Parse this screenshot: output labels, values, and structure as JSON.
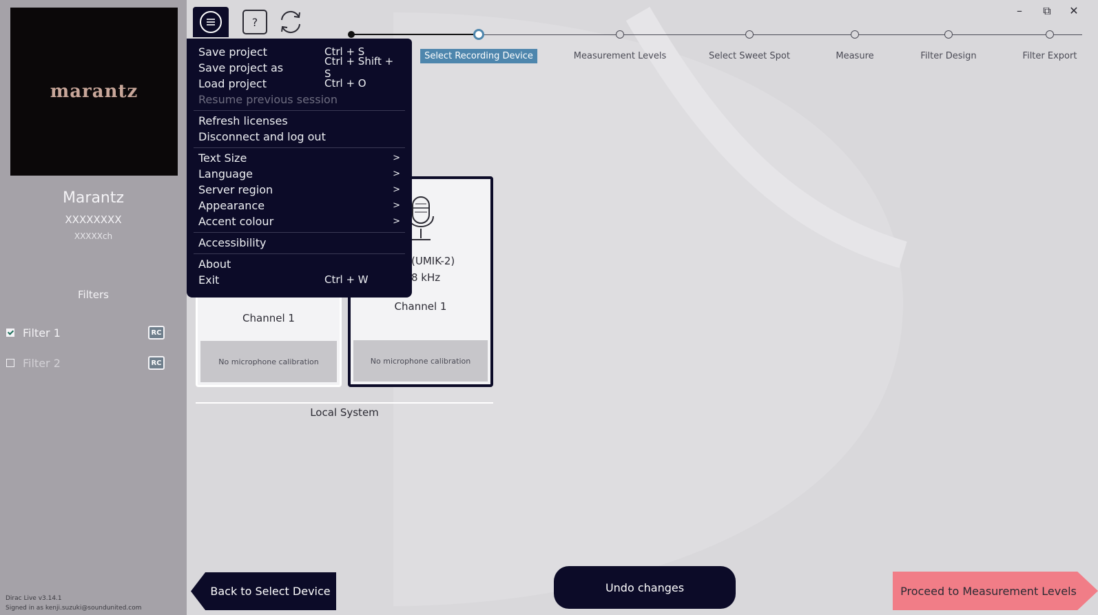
{
  "sidebar": {
    "logo_text": "marantz",
    "device_name": "Marantz",
    "device_serial": "XXXXXXXX",
    "device_channels": "XXXXXch",
    "filters_title": "Filters",
    "filters": [
      {
        "label": "Filter 1",
        "checked": true,
        "badge": "RC"
      },
      {
        "label": "Filter 2",
        "checked": false,
        "badge": "RC"
      }
    ],
    "version": "Dirac Live v3.14.1",
    "signed_in": "Signed in as kenji.suzuki@soundunited.com"
  },
  "toolbar": {
    "menu_icon": "hamburger-icon",
    "help_label": "?",
    "sync_icon": "sync-icon",
    "window_controls": {
      "minimize": "–",
      "maximize": "⧉",
      "close": "✕"
    }
  },
  "steps": [
    {
      "label": "Select Recording Device",
      "active": true
    },
    {
      "label": "Measurement Levels",
      "active": false
    },
    {
      "label": "Select Sweet Spot",
      "active": false
    },
    {
      "label": "Measure",
      "active": false
    },
    {
      "label": "Filter Design",
      "active": false
    },
    {
      "label": "Filter Export",
      "active": false
    }
  ],
  "devices": [
    {
      "line1": "",
      "line2": "",
      "channel": "Channel 1",
      "calibration": "No microphone calibration"
    },
    {
      "line1": "(UMIK-2)",
      "line2": "8 kHz",
      "channel": "Channel 1",
      "calibration": "No microphone calibration"
    }
  ],
  "local_system_label": "Local System",
  "menu": {
    "save": {
      "label": "Save project",
      "shortcut": "Ctrl + S"
    },
    "save_as": {
      "label": "Save project as",
      "shortcut": "Ctrl + Shift + S"
    },
    "load": {
      "label": "Load project",
      "shortcut": "Ctrl + O"
    },
    "resume": {
      "label": "Resume previous session"
    },
    "refresh": {
      "label": "Refresh licenses"
    },
    "disconnect": {
      "label": "Disconnect and log out"
    },
    "text_size": {
      "label": "Text Size",
      "arrow": ">"
    },
    "language": {
      "label": "Language",
      "arrow": ">"
    },
    "server_region": {
      "label": "Server region",
      "arrow": ">"
    },
    "appearance": {
      "label": "Appearance",
      "arrow": ">"
    },
    "accent_colour": {
      "label": "Accent colour",
      "arrow": ">"
    },
    "accessibility": {
      "label": "Accessibility"
    },
    "about": {
      "label": "About"
    },
    "exit": {
      "label": "Exit",
      "shortcut": "Ctrl + W"
    }
  },
  "buttons": {
    "back": "Back to Select Device",
    "undo": "Undo changes",
    "proceed": "Proceed to Measurement Levels"
  },
  "colors": {
    "sidebar_bg": "#a5a2a8",
    "main_bg": "#d9d8db",
    "dark_navy": "#0c0b28",
    "accent_blue": "#4e86ad",
    "proceed_pink": "#f17d87"
  }
}
